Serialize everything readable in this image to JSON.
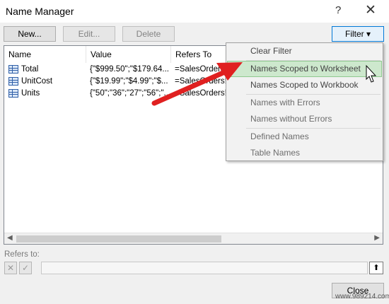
{
  "window": {
    "title": "Name Manager",
    "help_glyph": "?",
    "close_glyph": "✕"
  },
  "toolbar": {
    "new_label": "New...",
    "edit_label": "Edit...",
    "delete_label": "Delete",
    "filter_label": "Filter ▾"
  },
  "table": {
    "columns": [
      "Name",
      "Value",
      "Refers To"
    ],
    "rows": [
      {
        "name": "Total",
        "value": "{\"$999.50\";\"$179.64...",
        "refers_to": "=SalesOrders!"
      },
      {
        "name": "UnitCost",
        "value": "{\"$19.99\";\"$4.99\";\"$...",
        "refers_to": "=SalesOrders!"
      },
      {
        "name": "Units",
        "value": "{\"50\";\"36\";\"27\";\"56\";\"...",
        "refers_to": "=SalesOrders!"
      }
    ],
    "scroll_left": "◀",
    "scroll_right": "▶"
  },
  "filter_menu": {
    "items": [
      {
        "label": "Clear Filter"
      },
      {
        "label": "Names Scoped to Worksheet",
        "highlighted": true
      },
      {
        "label": "Names Scoped to Workbook"
      },
      {
        "label": "Names with Errors"
      },
      {
        "label": "Names without Errors"
      },
      {
        "label": "Defined Names"
      },
      {
        "label": "Table Names"
      }
    ]
  },
  "refers": {
    "label": "Refers to:",
    "cancel_glyph": "✕",
    "confirm_glyph": "✓",
    "value": "",
    "collapse_glyph": "⬆"
  },
  "footer": {
    "close_label": "Close"
  },
  "watermark": "www.989214.com",
  "colors": {
    "annotation_arrow": "#e02020",
    "highlight": "#cde8cd",
    "filter_border": "#0078d7"
  }
}
